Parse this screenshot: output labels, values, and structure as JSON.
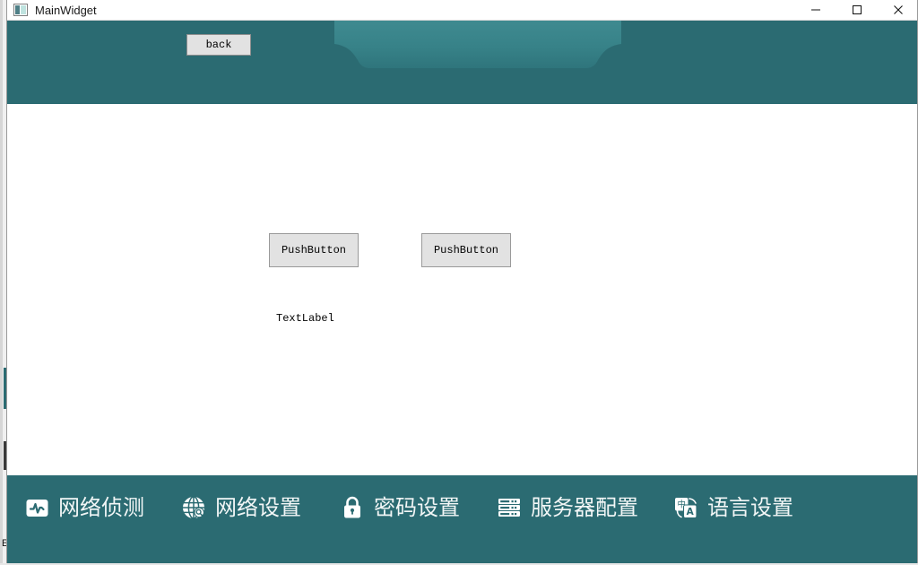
{
  "window": {
    "title": "MainWidget",
    "icon": "app-icon",
    "controls": [
      {
        "name": "minimize",
        "glyph": "minimize-icon"
      },
      {
        "name": "maximize",
        "glyph": "maximize-icon"
      },
      {
        "name": "close",
        "glyph": "close-icon"
      }
    ]
  },
  "header": {
    "back_label": "back",
    "background_color": "#2b6b72",
    "tab_highlight_color": "#3d858b"
  },
  "content": {
    "buttons": [
      {
        "label": "PushButton"
      },
      {
        "label": "PushButton"
      }
    ],
    "text_label": "TextLabel"
  },
  "bottom_nav": {
    "background_color": "#2b6b72",
    "text_color": "#f2f6f6",
    "items": [
      {
        "label": "网络侦测",
        "icon": "network-monitor-icon"
      },
      {
        "label": "网络设置",
        "icon": "globe-icon"
      },
      {
        "label": "密码设置",
        "icon": "lock-icon"
      },
      {
        "label": "服务器配置",
        "icon": "server-rack-icon"
      },
      {
        "label": "语言设置",
        "icon": "translate-icon"
      }
    ]
  },
  "background_window": {
    "fragment_text": "E:"
  }
}
